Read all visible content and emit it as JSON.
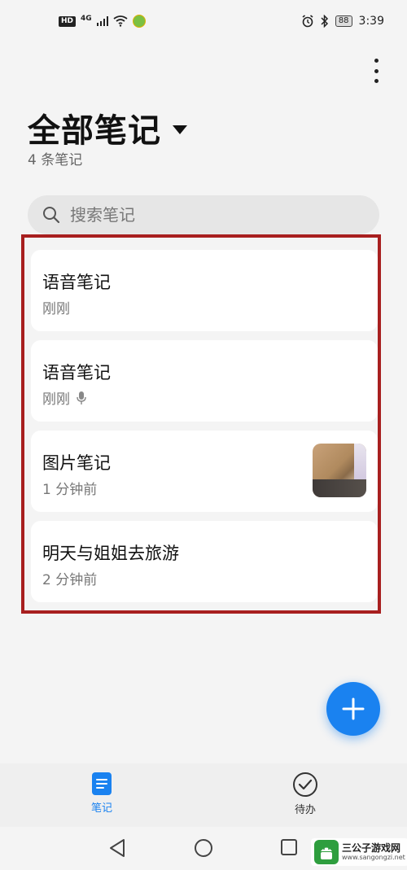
{
  "status_bar": {
    "network": "4G",
    "battery": "88",
    "time": "3:39",
    "hd_label": "HD"
  },
  "header": {
    "title": "全部笔记",
    "note_count": "4 条笔记"
  },
  "search": {
    "placeholder": "搜索笔记"
  },
  "notes": [
    {
      "title": "语音笔记",
      "time": "刚刚"
    },
    {
      "title": "语音笔记",
      "time": "刚刚",
      "icon": "microphone-icon"
    },
    {
      "title": "图片笔记",
      "time": "1 分钟前",
      "thumbnail": "image-thumbnail"
    },
    {
      "title": "明天与姐姐去旅游",
      "time": "2 分钟前"
    }
  ],
  "bottom_tabs": [
    {
      "label": "笔记",
      "icon": "notes-icon",
      "active": true
    },
    {
      "label": "待办",
      "icon": "check-circle-icon",
      "active": false
    }
  ],
  "watermark": {
    "title": "三公子游戏网",
    "url": "www.sangongzi.net"
  },
  "colors": {
    "accent": "#1a82f0",
    "highlight_frame": "#a81f1f",
    "background": "#f4f4f4",
    "card": "#ffffff"
  }
}
